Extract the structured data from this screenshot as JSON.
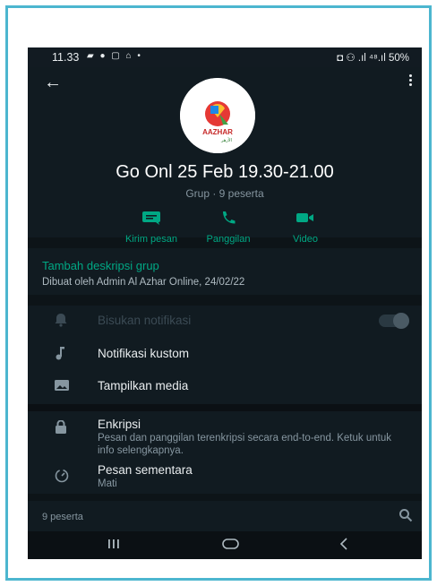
{
  "status_bar": {
    "time": "11.33",
    "left_icons": "▰ ● ▢ ⌂ •",
    "right_text": "◘ ⚇ .ıl ⁴⁸.ıl 50%"
  },
  "header": {
    "group_name": "Go Onl 25 Feb 19.30-21.00",
    "subtitle": "Grup · 9 peserta",
    "logo_text": "AAZHAR",
    "logo_subtext": "الأزهر"
  },
  "actions": [
    {
      "label": "Kirim pesan",
      "icon": "message-icon"
    },
    {
      "label": "Panggilan",
      "icon": "phone-icon"
    },
    {
      "label": "Video",
      "icon": "video-icon"
    }
  ],
  "description": {
    "add_label": "Tambah deskripsi grup",
    "created_by": "Dibuat oleh Admin Al Azhar Online, 24/02/22"
  },
  "settings": {
    "mute": "Bisukan notifikasi",
    "custom_notif": "Notifikasi kustom",
    "media": "Tampilkan media",
    "encryption_title": "Enkripsi",
    "encryption_desc": "Pesan dan panggilan terenkripsi secara end-to-end. Ketuk untuk info selengkapnya.",
    "disappearing_title": "Pesan sementara",
    "disappearing_value": "Mati"
  },
  "participants": {
    "count_label": "9 peserta"
  },
  "colors": {
    "accent": "#00a884",
    "background": "#111b21",
    "frame_border": "#4cb6cf"
  }
}
